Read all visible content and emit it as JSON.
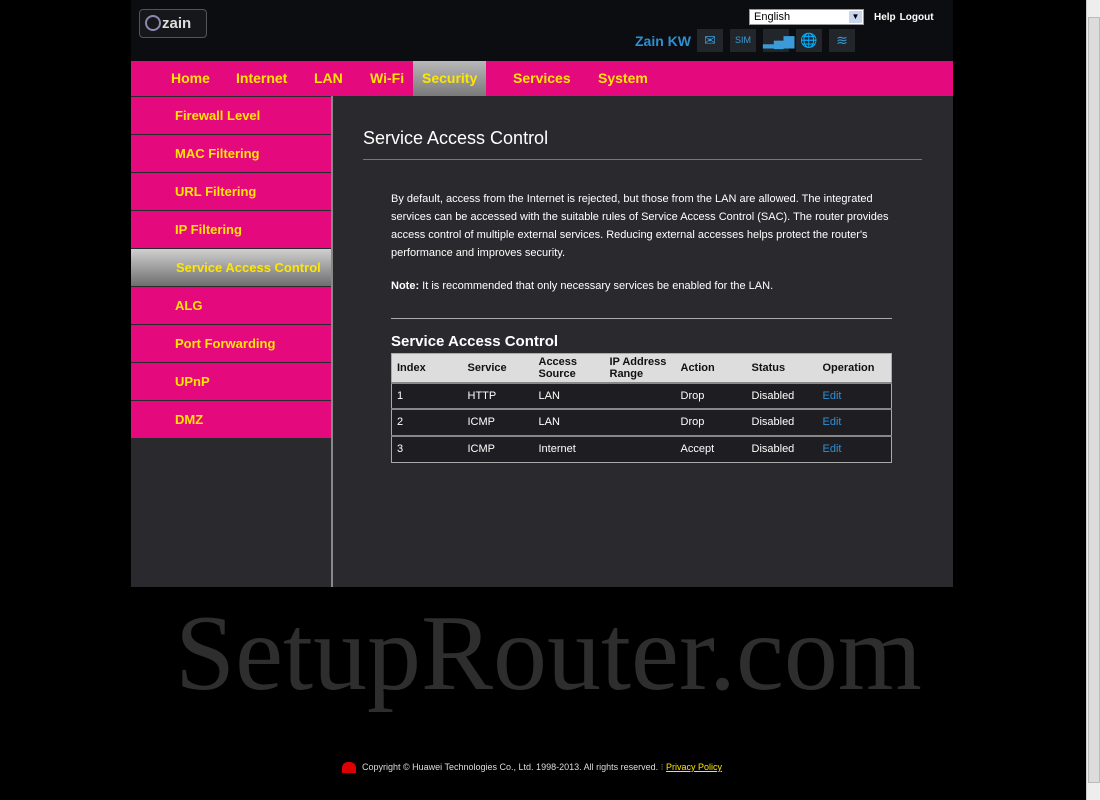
{
  "header": {
    "logo": "zain",
    "language": "English",
    "help": "Help",
    "logout": "Logout",
    "operator": "Zain KW",
    "status_icons": [
      "mail-icon",
      "sim-icon",
      "signal-icon",
      "internet-globe-icon",
      "wifi-icon"
    ]
  },
  "nav": [
    {
      "label": "Home"
    },
    {
      "label": "Internet"
    },
    {
      "label": "LAN"
    },
    {
      "label": "Wi-Fi"
    },
    {
      "label": "Security",
      "active": true
    },
    {
      "label": "Services"
    },
    {
      "label": "System"
    }
  ],
  "sidebar": [
    {
      "label": "Firewall Level"
    },
    {
      "label": "MAC Filtering"
    },
    {
      "label": "URL Filtering"
    },
    {
      "label": "IP Filtering"
    },
    {
      "label": "Service Access Control",
      "active": true
    },
    {
      "label": "ALG"
    },
    {
      "label": "Port Forwarding"
    },
    {
      "label": "UPnP"
    },
    {
      "label": "DMZ"
    }
  ],
  "main": {
    "title": "Service Access Control",
    "description": "By default, access from the Internet is rejected, but those from the LAN are allowed. The integrated services can be accessed with the suitable rules of Service Access Control (SAC). The router provides access control of multiple external services. Reducing external accesses helps protect the router's performance and improves security.",
    "note_label": "Note:",
    "note_text": " It is recommended that only necessary services be enabled for the LAN.",
    "table_title": "Service Access Control",
    "columns": [
      "Index",
      "Service",
      "Access Source",
      "IP Address Range",
      "Action",
      "Status",
      "Operation"
    ],
    "rows": [
      [
        "1",
        "HTTP",
        "LAN",
        "",
        "Drop",
        "Disabled",
        "Edit"
      ],
      [
        "2",
        "ICMP",
        "LAN",
        "",
        "Drop",
        "Disabled",
        "Edit"
      ],
      [
        "3",
        "ICMP",
        "Internet",
        "",
        "Accept",
        "Disabled",
        "Edit"
      ]
    ]
  },
  "watermark": "SetupRouter.com",
  "footer": {
    "copyright": "Copyright © Huawei Technologies Co., Ltd. 1998-2013. All rights reserved.",
    "separator": "⁝",
    "privacy": "Privacy Policy"
  },
  "colors": {
    "accent": "#e4097d",
    "nav_text": "#ffe600",
    "link": "#2f8fd6"
  }
}
